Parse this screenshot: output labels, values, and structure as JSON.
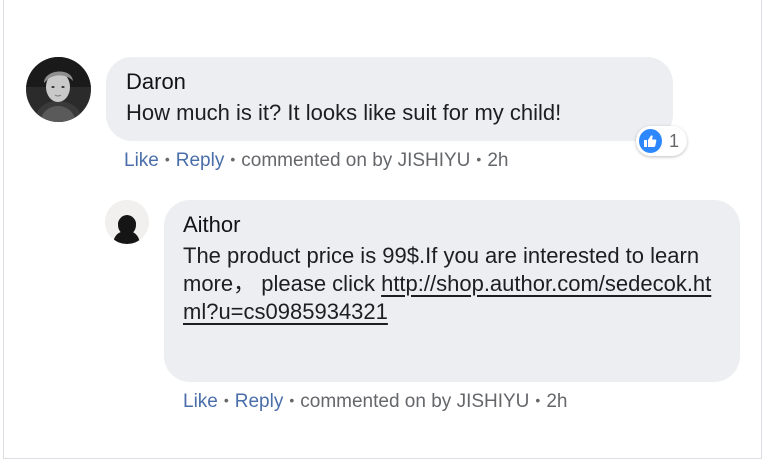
{
  "comment": {
    "author": "Daron",
    "avatar_icon": "user-photo-icon",
    "text": "How much is it?  It looks like suit for my child!",
    "reaction": {
      "icon": "thumbs-up-icon",
      "count": "1",
      "color": "#2d88ff"
    },
    "actions": {
      "like": "Like",
      "reply": "Reply",
      "commented_on": "commented on by",
      "by_name": "JISHIYU",
      "time": "2h"
    }
  },
  "reply": {
    "author": "Aithor",
    "avatar_icon": "user-silhouette-icon",
    "text": "The product price is 99$.If you are interested to learn more， please click ",
    "link": "http://shop.author.com/sedecok.html?u=cs0985934321",
    "actions": {
      "like": "Like",
      "reply": "Reply",
      "commented_on": "commented on by",
      "by_name": "JISHIYU",
      "time": "2h"
    }
  },
  "colors": {
    "bubble": "#eceef1",
    "action_link": "#4a6ea9",
    "meta_text": "#65676b"
  }
}
